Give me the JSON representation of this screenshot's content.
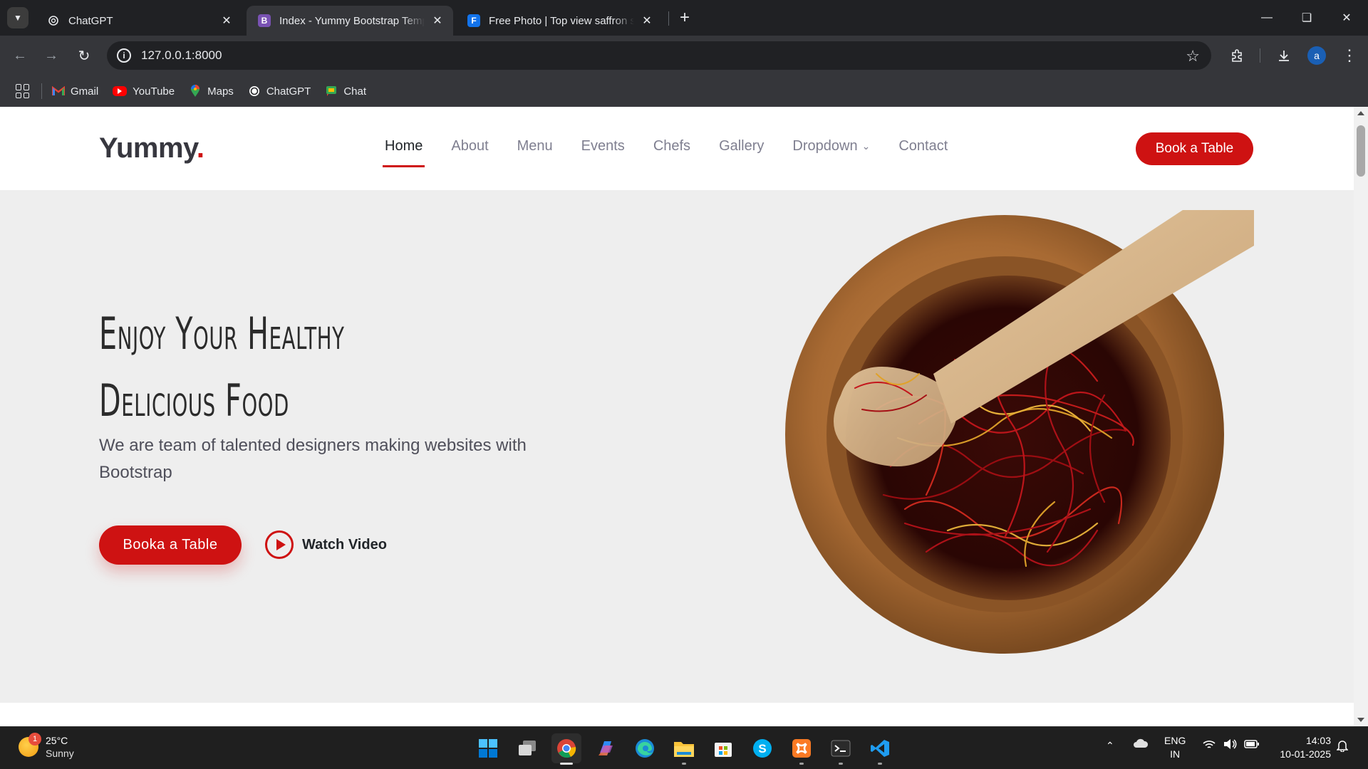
{
  "browser": {
    "tabs": [
      {
        "title": "ChatGPT",
        "favicon": "chatgpt-icon",
        "active": false
      },
      {
        "title": "Index - Yummy Bootstrap Template",
        "favicon": "bootstrap-icon",
        "active": true
      },
      {
        "title": "Free Photo | Top view saffron st",
        "favicon": "freepik-icon",
        "active": false
      }
    ],
    "url": "127.0.0.1:8000",
    "profile_initial": "a",
    "bookmarks": [
      {
        "label": "Gmail",
        "icon": "gmail-icon"
      },
      {
        "label": "YouTube",
        "icon": "youtube-icon"
      },
      {
        "label": "Maps",
        "icon": "maps-icon"
      },
      {
        "label": "ChatGPT",
        "icon": "chatgpt-icon"
      },
      {
        "label": "Chat",
        "icon": "google-chat-icon"
      }
    ]
  },
  "site": {
    "logo": "Yummy",
    "logo_dot": ".",
    "nav": [
      "Home",
      "About",
      "Menu",
      "Events",
      "Chefs",
      "Gallery",
      "Dropdown",
      "Contact"
    ],
    "nav_active": "Home",
    "header_cta": "Book a Table",
    "hero": {
      "title_line1": "Enjoy Your Healthy",
      "title_line2": "Delicious Food",
      "subtitle": "We are team of talented designers making websites with Bootstrap",
      "cta": "Booka a Table",
      "video_link": "Watch Video",
      "image": "saffron-in-wooden-bowl-image"
    },
    "accent_color": "#ce1212"
  },
  "taskbar": {
    "weather": {
      "temp": "25°C",
      "condition": "Sunny",
      "badge": "1"
    },
    "apps": [
      "start-icon",
      "task-view-icon",
      "chrome-icon",
      "copilot-icon",
      "edge-icon",
      "file-explorer-icon",
      "microsoft-store-icon",
      "skype-icon",
      "xampp-icon",
      "terminal-icon",
      "vscode-icon"
    ],
    "language": "ENG",
    "region": "IN",
    "time": "14:03",
    "date": "10-01-2025"
  }
}
